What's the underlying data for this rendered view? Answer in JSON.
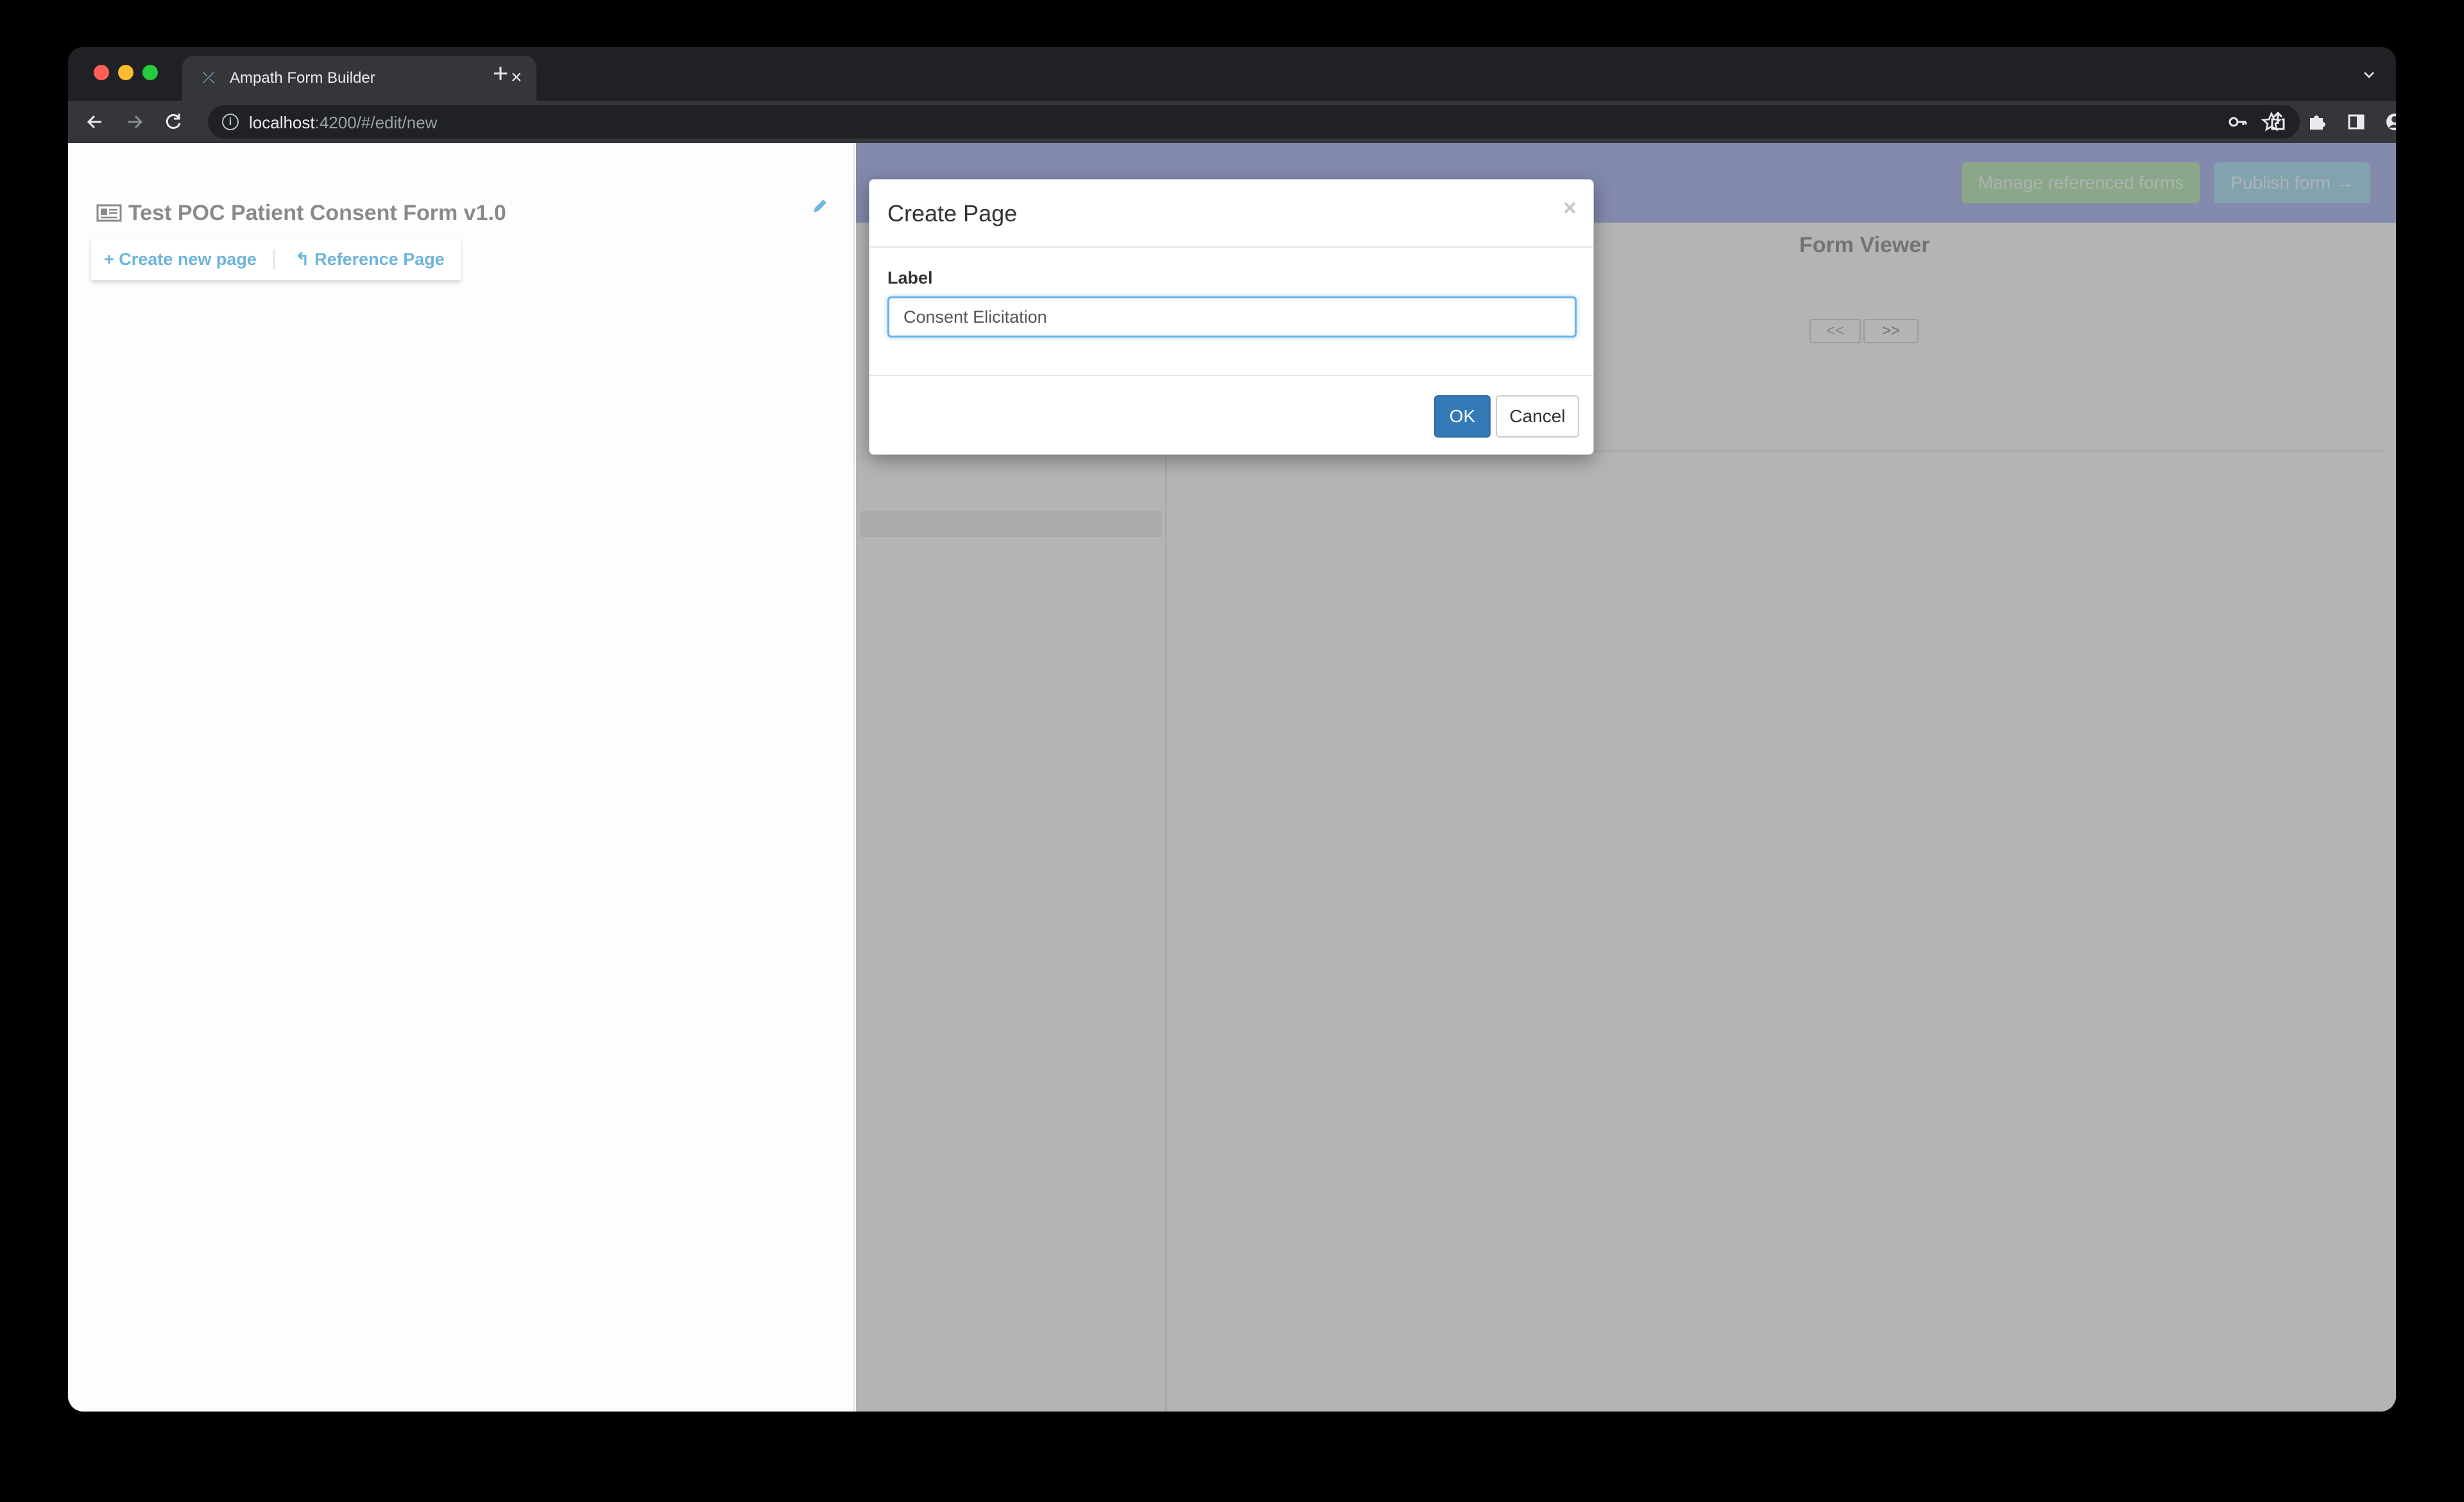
{
  "browser": {
    "tab_title": "Ampath Form Builder",
    "tab_close": "×",
    "new_tab": "+",
    "url_host": "localhost",
    "url_path": ":4200/#/edit/new"
  },
  "left_panel": {
    "form_title": "Test POC Patient Consent Form v1.0",
    "create_new_page": "+ Create new page",
    "reference_page": "↰ Reference Page"
  },
  "right_panel": {
    "manage_referenced_forms": "Manage referenced forms",
    "publish_form": "Publish form →",
    "viewer_title": "Form Viewer",
    "prev_page": "<<",
    "next_page": ">>"
  },
  "modal": {
    "title": "Create Page",
    "close": "×",
    "label": "Label",
    "input_value": "Consent Elicitation",
    "ok": "OK",
    "cancel": "Cancel"
  },
  "colors": {
    "accent": "#337ab7",
    "link": "#6fb4dd",
    "header_band": "#b8bff0"
  }
}
